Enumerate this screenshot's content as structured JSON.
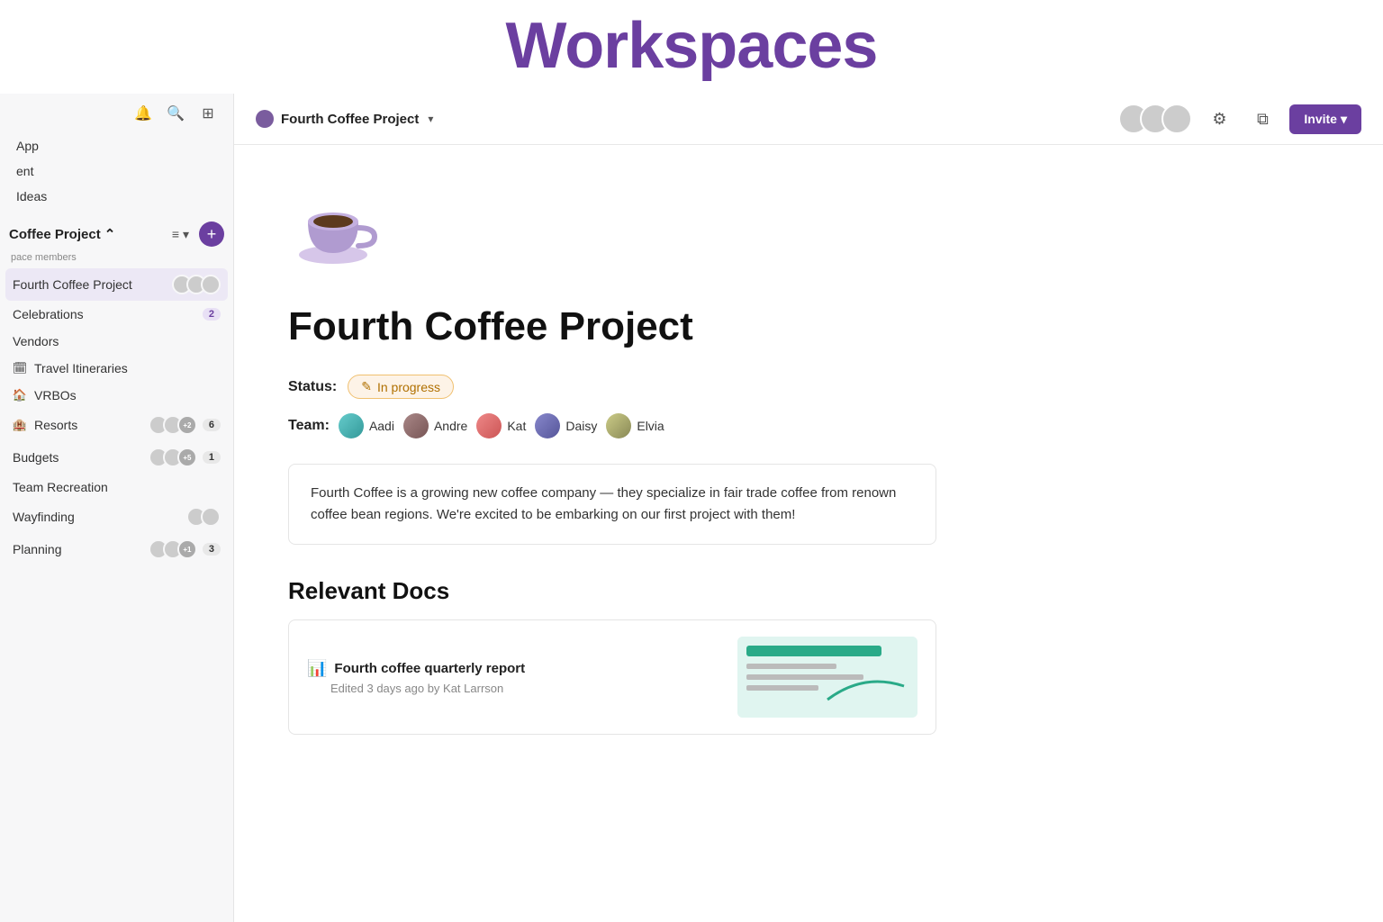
{
  "banner": {
    "title": "Workspaces"
  },
  "sidebar": {
    "nav_items": [
      {
        "label": "App",
        "id": "app"
      },
      {
        "label": "ent",
        "id": "ent"
      },
      {
        "label": "Ideas",
        "id": "ideas"
      }
    ],
    "workspace_title": "Coffee Project",
    "workspace_chevron": "⌃",
    "members_label": "pace members",
    "list_items": [
      {
        "id": "fourth-coffee-project",
        "label": "Fourth Coffee Project",
        "active": true,
        "avatars": [
          "av-pink",
          "av-purple",
          "av-teal"
        ],
        "badge": null
      },
      {
        "id": "celebrations",
        "label": "Celebrations",
        "active": false,
        "avatars": [],
        "badge": "2",
        "badge_color": "purple"
      },
      {
        "id": "vendors",
        "label": "Vendors",
        "active": false,
        "avatars": [],
        "badge": null
      },
      {
        "id": "travel-itineraries",
        "label": "Travel Itineraries",
        "active": false,
        "avatars": [],
        "badge": null,
        "icon": "🗓"
      },
      {
        "id": "vrbos",
        "label": "VRBOs",
        "active": false,
        "avatars": [],
        "badge": null,
        "icon": "🏠"
      },
      {
        "id": "resorts",
        "label": "Resorts",
        "active": false,
        "avatars": [
          "av-orange",
          "av-green",
          "+2"
        ],
        "badge": "6",
        "icon": "🏨"
      },
      {
        "id": "budgets",
        "label": "Budgets",
        "active": false,
        "avatars": [
          "av-teal",
          "av-gold",
          "+5"
        ],
        "badge": "1"
      },
      {
        "id": "team-recreation",
        "label": "Team Recreation",
        "active": false,
        "avatars": [],
        "badge": null
      },
      {
        "id": "wayfinding",
        "label": "Wayfinding",
        "active": false,
        "avatars": [
          "av-pink",
          "av-blue"
        ],
        "badge": null
      },
      {
        "id": "planning",
        "label": "Planning",
        "active": false,
        "avatars": [
          "av-orange",
          "av-purple",
          "+1"
        ],
        "badge": "3"
      }
    ]
  },
  "header": {
    "workspace_dot_color": "#7a5c9e",
    "project_name": "Fourth Coffee Project",
    "avatars": [
      "av-pink",
      "av-purple",
      "av-teal"
    ],
    "invite_label": "Invite",
    "invite_dropdown": "▾"
  },
  "main": {
    "project_icon": "☕",
    "project_title": "Fourth Coffee Project",
    "status_label": "Status:",
    "status_value": "In progress",
    "team_label": "Team:",
    "team_members": [
      {
        "name": "Aadi",
        "color": "av-teal"
      },
      {
        "name": "Andre",
        "color": "av-purple"
      },
      {
        "name": "Kat",
        "color": "av-pink"
      },
      {
        "name": "Daisy",
        "color": "av-blue"
      },
      {
        "name": "Elvia",
        "color": "av-gold"
      }
    ],
    "description": "Fourth Coffee is a growing new coffee company — they specialize in fair trade coffee from renown coffee bean regions. We're excited to be embarking on our first project with them!",
    "relevant_docs_title": "Relevant Docs",
    "docs": [
      {
        "id": "quarterly-report",
        "icon": "📊",
        "title": "Fourth coffee quarterly report",
        "meta": "Edited 3 days ago by Kat Larrson"
      }
    ]
  }
}
